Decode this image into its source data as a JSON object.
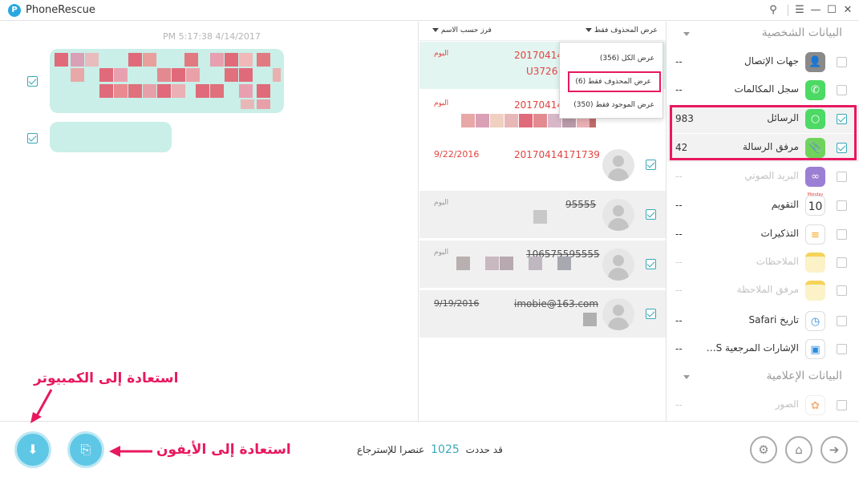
{
  "app": {
    "title": "PhoneRescue"
  },
  "conversation": {
    "timestamp": "PM 5:17:38 4/14/2017"
  },
  "list_header": {
    "sort_label": "فرز حسب الاسم",
    "filter_label": "عرض المحذوف فقط"
  },
  "dropdown": {
    "items": [
      "عرض الكل (356)",
      "عرض المحذوف فقط (6)",
      "عرض الموجود فقط (350)"
    ]
  },
  "messages": [
    {
      "name": "20170414",
      "sub": "U3726",
      "date": "اليوم"
    },
    {
      "name": "20170414",
      "date": "اليوم"
    },
    {
      "name": "20170414171739",
      "date": "9/22/2016"
    },
    {
      "name": "95555",
      "date": "اليوم"
    },
    {
      "name": "106575595555",
      "date": "اليوم"
    },
    {
      "name": "imobie@163.com",
      "date": "9/19/2016"
    }
  ],
  "sidebar": {
    "personal_title": "البيانات الشخصية",
    "media_title": "البيانات الإعلامية",
    "items": [
      {
        "label": "جهات الإتصال",
        "count": "--",
        "icon": "contacts-icon"
      },
      {
        "label": "سجل المكالمات",
        "count": "--",
        "icon": "phone-icon"
      },
      {
        "label": "الرسائل",
        "count": "983",
        "icon": "messages-icon"
      },
      {
        "label": "مرفق الرسالة",
        "count": "42",
        "icon": "attachment-icon"
      },
      {
        "label": "البريد الصوتي",
        "count": "--",
        "icon": "voicemail-icon"
      },
      {
        "label": "التقويم",
        "count": "--",
        "icon": "calendar-icon",
        "icon_text": "10",
        "icon_month": "Monday"
      },
      {
        "label": "التذكيرات",
        "count": "--",
        "icon": "reminders-icon"
      },
      {
        "label": "الملاحظات",
        "count": "--",
        "icon": "notes-icon"
      },
      {
        "label": "مرفق الملاحظة",
        "count": "--",
        "icon": "notes-attachment-icon"
      },
      {
        "label": "تاريخ Safari",
        "count": "--",
        "icon": "safari-icon"
      },
      {
        "label": "الإشارات المرجعية S…",
        "count": "--",
        "icon": "bookmarks-icon"
      },
      {
        "label": "الصور",
        "count": "--",
        "icon": "photos-icon"
      }
    ]
  },
  "footer": {
    "status_prefix": "قد حددت",
    "status_count": "1025",
    "status_suffix": "عنصرا للإسترجاع"
  },
  "annotations": {
    "to_computer": "استعادة إلى الكمبيوتر",
    "to_iphone": "استعادة إلى الأيفون"
  },
  "colors": {
    "accent": "#3aa7b8",
    "highlight": "#e8185f",
    "deleted_red": "#e0443f"
  }
}
